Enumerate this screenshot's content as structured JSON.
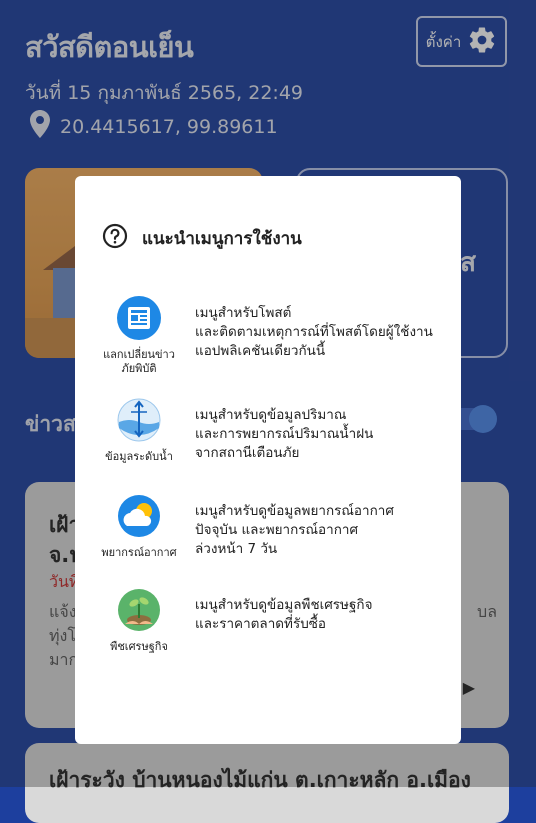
{
  "header": {
    "greeting": "สวัสดีตอนเย็น",
    "datetime": "วันที่ 15 กุมภาพันธ์ 2565, 22:49",
    "coordinates": "20.4415617, 99.89611",
    "settings_label": "ตั้งค่า"
  },
  "cards": {
    "right_peek_text": "ส"
  },
  "news": {
    "section_label": "ข่าวส",
    "card1": {
      "title_line1": "เฝ้า",
      "title_line2": "จ.น",
      "date_text": "วันที่",
      "body_line1": "แจ้ง",
      "body_line2": "ทุ่งโ",
      "body_line3": "มาก",
      "side_text": "บล"
    },
    "card2": {
      "title": "เฝ้าระวัง บ้านหนองไม้แก่น ต.เกาะหลัก อ.เมือง"
    }
  },
  "modal": {
    "title": "แนะนำเมนูการใช้งาน",
    "items": [
      {
        "icon": "news-exchange-icon",
        "label_lines": [
          "แลกเปลี่ยนข่าว",
          "ภัยพิบัติ"
        ],
        "desc_lines": [
          "เมนูสำหรับโพสต์",
          "และติดตามเหตุการณ์ที่โพสต์โดยผู้ใช้งาน",
          "แอปพลิเคชันเดียวกันนี้"
        ]
      },
      {
        "icon": "water-level-icon",
        "label_lines": [
          "ข้อมูลระดับน้ำ"
        ],
        "desc_lines": [
          "เมนูสำหรับดูข้อมูลปริมาณ",
          "และการพยากรณ์ปริมาณน้ำฝน",
          "จากสถานีเตือนภัย"
        ]
      },
      {
        "icon": "weather-icon",
        "label_lines": [
          "พยากรณ์อากาศ"
        ],
        "desc_lines": [
          "เมนูสำหรับดูข้อมูลพยากรณ์อากาศ",
          "ปัจจุบัน และพยากรณ์อากาศ",
          "ล่วงหน้า 7 วัน"
        ]
      },
      {
        "icon": "crop-icon",
        "label_lines": [
          "พืชเศรษฐกิจ"
        ],
        "desc_lines": [
          "เมนูสำหรับดูข้อมูลพืชเศรษฐกิจ",
          "และราคาตลาดที่รับซื้อ"
        ]
      }
    ]
  },
  "colors": {
    "background": "#1d3f9e",
    "accent_red": "#c62828",
    "icon_blue": "#1e88e5",
    "toggle_knob": "#4a86e8"
  }
}
